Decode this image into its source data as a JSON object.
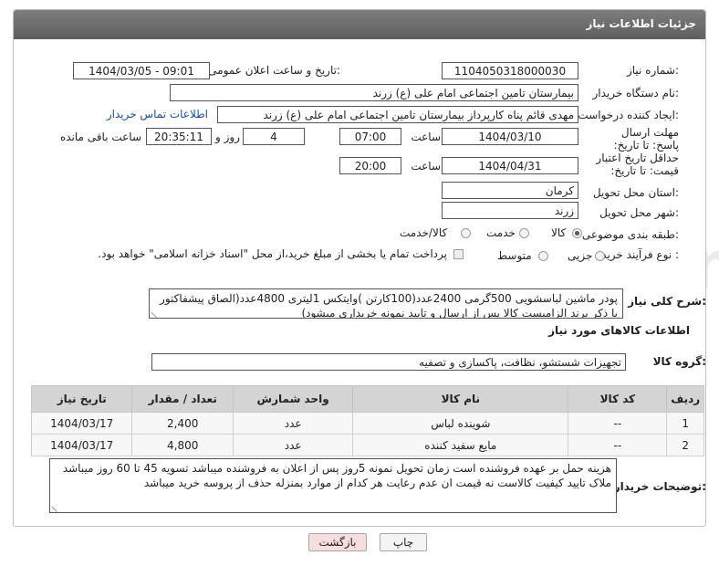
{
  "header": {
    "title": "جزئیات اطلاعات نیاز"
  },
  "labels": {
    "need_number": "شماره نیاز:",
    "announce_datetime": "تاریخ و ساعت اعلان عمومی:",
    "buyer_org": "نام دستگاه خریدار:",
    "requester": "ایجاد کننده درخواست:",
    "deadline_send": "مهلت ارسال پاسخ: تا تاریخ:",
    "price_valid": "حداقل تاریخ اعتبار قیمت: تا تاریخ:",
    "hour": "ساعت",
    "day_and": "روز و",
    "remaining": "ساعت باقی مانده",
    "province": "استان محل تحویل:",
    "city": "شهر محل تحویل:",
    "category": "طبقه بندی موضوعی:",
    "process_type": "نوع فرآیند خرید :",
    "overview": "شرح کلی نیاز:",
    "goods_info": "اطلاعات کالاهای مورد نیاز",
    "goods_group": "گروه کالا:",
    "buyer_notes": "توضیحات خریدار:"
  },
  "fields": {
    "need_number": "1104050318000030",
    "announce_datetime": "1404/03/05 - 09:01",
    "buyer_org": "بیمارستان تامین اجتماعی امام علی (ع) زرند",
    "requester": "مهدی  قائم پناه  کارپرداز بیمارستان تامین اجتماعی امام علی (ع) زرند",
    "contact_link": "اطلاعات تماس خریدار",
    "deadline_date": "1404/03/10",
    "deadline_time": "07:00",
    "days": "4",
    "remaining_time": "20:35:11",
    "price_valid_date": "1404/04/31",
    "price_valid_time": "20:00",
    "province": "کرمان",
    "city": "زرند",
    "overview": "پودر ماشین لباسشویی 500گرمی 2400عدد(100کارتن )وایتکس 1لیتری 4800عدد(الصاق پیشفاکتور با ذکر برند الزامیست کالا پس از ارسال و تایید نمونه خریداری میشود)",
    "goods_group": "تجهیزات شستشو، نظافت، پاکسازی و تصفیه",
    "buyer_notes": "هزینه حمل بر عهده فروشنده است زمان تحویل نمونه 5روز پس از اعلان به فروشنده میباشد تسویه 45 تا 60 روز میباشد ملاک تایید کیفیت کالاست نه قیمت ان عدم رعایت هر کدام از موارد بمنزله حذف از پروسه خرید میباشد"
  },
  "category_options": [
    {
      "label": "کالا",
      "selected": true
    },
    {
      "label": "خدمت",
      "selected": false
    },
    {
      "label": "کالا/خدمت",
      "selected": false
    }
  ],
  "process_options": [
    {
      "label": "جزیی",
      "selected": false
    },
    {
      "label": "متوسط",
      "selected": false
    }
  ],
  "payment_note": "پرداخت تمام یا بخشی از مبلغ خرید،از محل \"اسناد خزانه اسلامی\" خواهد بود.",
  "table": {
    "headers": [
      "ردیف",
      "کد کالا",
      "نام کالا",
      "واحد شمارش",
      "تعداد / مقدار",
      "تاریخ نیاز"
    ],
    "rows": [
      [
        "1",
        "--",
        "شوینده لباس",
        "عدد",
        "2,400",
        "1404/03/17"
      ],
      [
        "2",
        "--",
        "مایع سفید کننده",
        "عدد",
        "4,800",
        "1404/03/17"
      ]
    ]
  },
  "buttons": {
    "print": "چاپ",
    "back": "بازگشت"
  },
  "colors": {
    "header_bg": "#6e6e6e",
    "table_header_bg": "#d4d4d4",
    "link": "#1a4fa0",
    "back_button_bg": "#f7dede"
  }
}
